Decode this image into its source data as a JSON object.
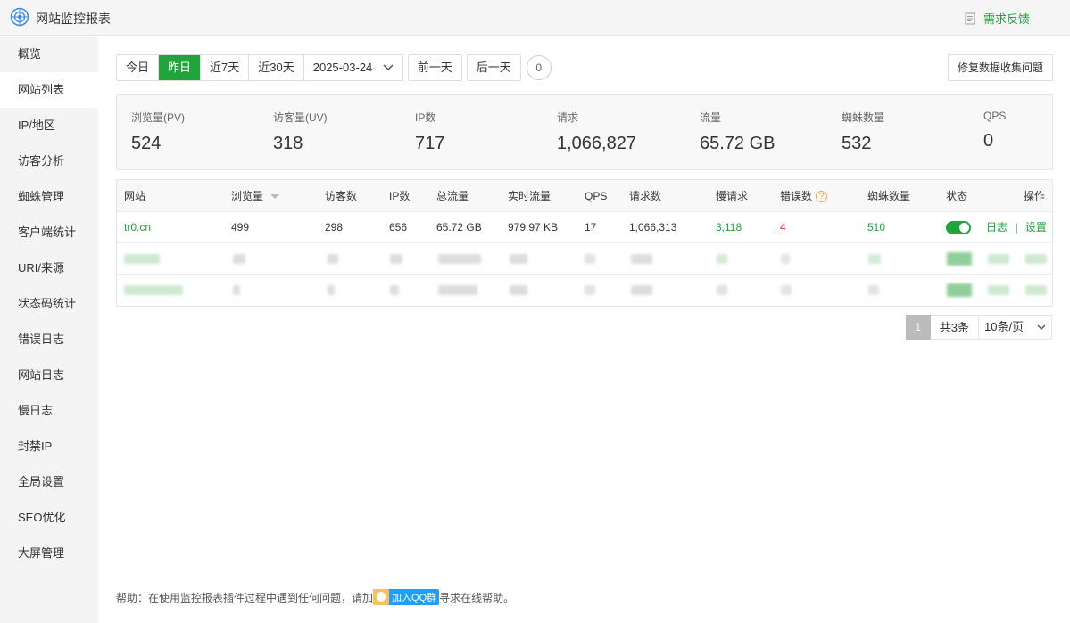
{
  "app": {
    "title": "网站监控报表",
    "feedback_label": "需求反馈"
  },
  "sidebar": {
    "items": [
      {
        "label": "概览"
      },
      {
        "label": "网站列表"
      },
      {
        "label": "IP/地区"
      },
      {
        "label": "访客分析"
      },
      {
        "label": "蜘蛛管理"
      },
      {
        "label": "客户端统计"
      },
      {
        "label": "URI/来源"
      },
      {
        "label": "状态码统计"
      },
      {
        "label": "错误日志"
      },
      {
        "label": "网站日志"
      },
      {
        "label": "慢日志"
      },
      {
        "label": "封禁IP"
      },
      {
        "label": "全局设置"
      },
      {
        "label": "SEO优化"
      },
      {
        "label": "大屏管理"
      }
    ],
    "active": "网站列表"
  },
  "toolbar": {
    "today": "今日",
    "yesterday": "昨日",
    "last7": "近7天",
    "last30": "近30天",
    "date": "2025-03-24",
    "prev_day": "前一天",
    "next_day": "后一天",
    "badge": "0",
    "repair": "修复数据收集问题"
  },
  "stats": [
    {
      "label": "浏览量(PV)",
      "value": "524"
    },
    {
      "label": "访客量(UV)",
      "value": "318"
    },
    {
      "label": "IP数",
      "value": "717"
    },
    {
      "label": "请求",
      "value": "1,066,827"
    },
    {
      "label": "流量",
      "value": "65.72 GB"
    },
    {
      "label": "蜘蛛数量",
      "value": "532"
    },
    {
      "label": "QPS",
      "value": "0"
    }
  ],
  "table": {
    "headers": {
      "site": "网站",
      "pv": "浏览量",
      "uv": "访客数",
      "ip": "IP数",
      "traffic": "总流量",
      "realtime": "实时流量",
      "qps": "QPS",
      "requests": "请求数",
      "slow": "慢请求",
      "errors": "错误数",
      "spiders": "蜘蛛数量",
      "status": "状态",
      "ops": "操作"
    },
    "rows": [
      {
        "site": "tr0.cn",
        "pv": "499",
        "uv": "298",
        "ip": "656",
        "traffic": "65.72 GB",
        "realtime": "979.97 KB",
        "qps": "17",
        "requests": "1,066,313",
        "slow": "3,118",
        "errors": "4",
        "spiders": "510",
        "log_link": "日志",
        "sep": "|",
        "settings_link": "设置"
      }
    ]
  },
  "pagination": {
    "current": "1",
    "total": "共3条",
    "page_size": "10条/页"
  },
  "help": {
    "prefix": "帮助：在使用监控报表插件过程中遇到任何问题，请加",
    "qq_button": "加入QQ群",
    "suffix": "寻求在线帮助。"
  },
  "colors": {
    "accent": "#20a53a",
    "error": "#e12d2d",
    "qq": "#1e9fff"
  }
}
